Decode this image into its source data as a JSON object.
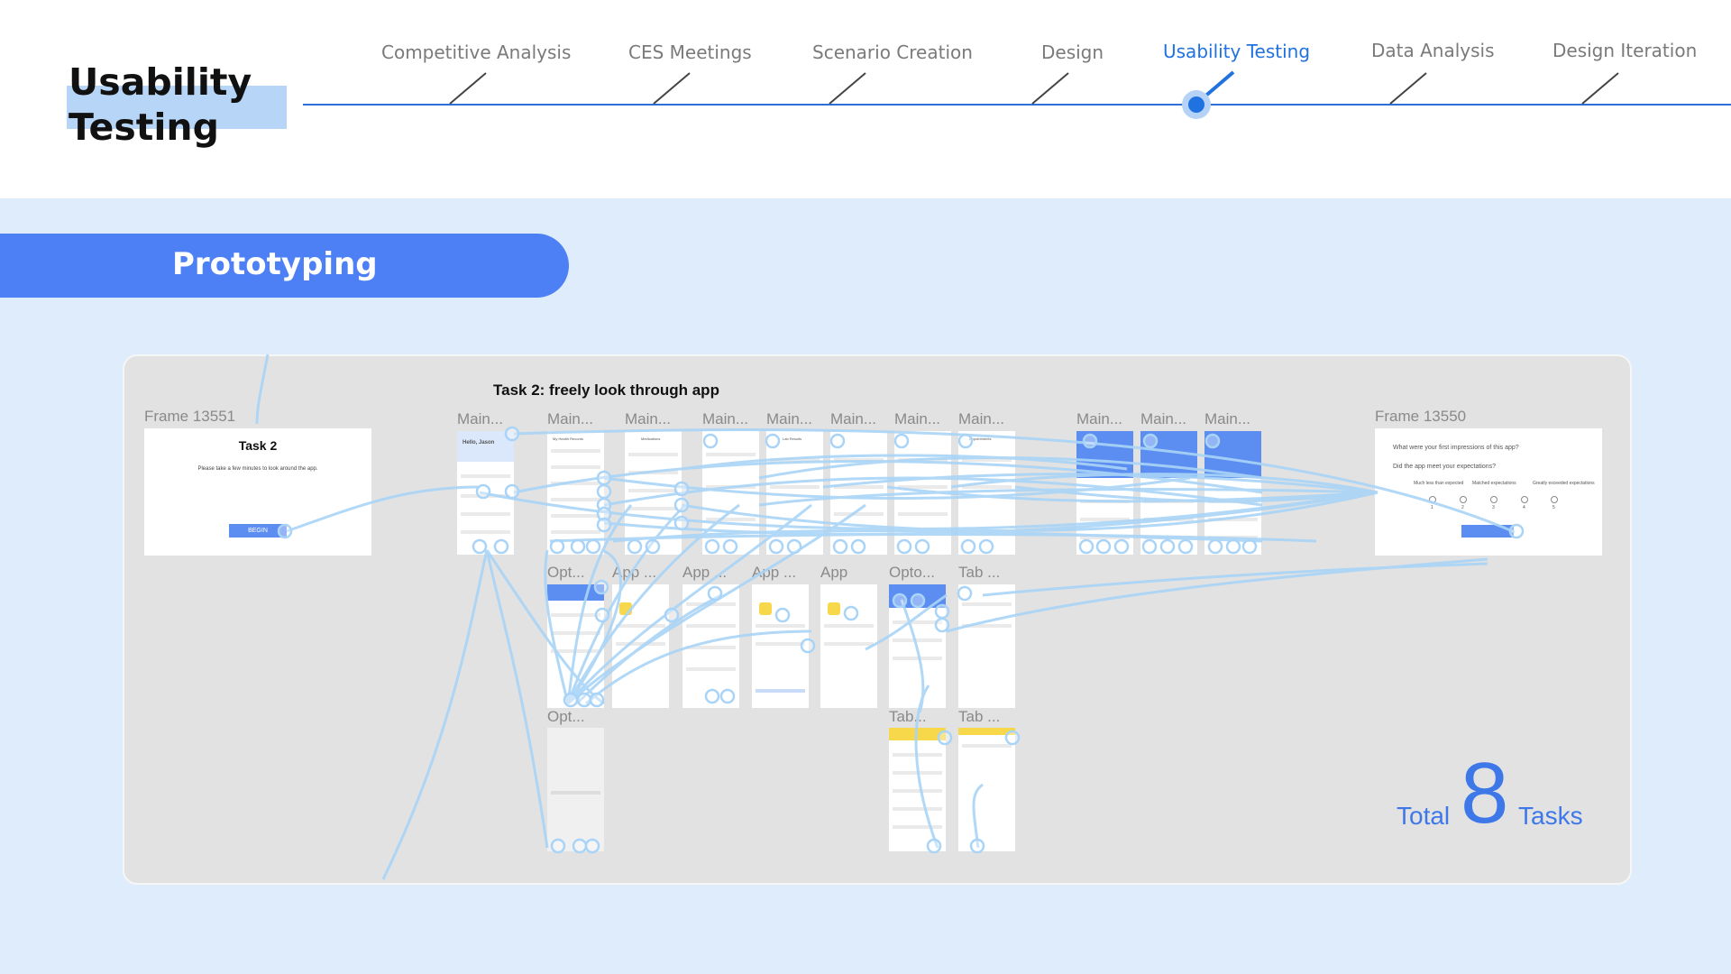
{
  "header": {
    "title": "Usability\nTesting",
    "stages": [
      {
        "label": "Competitive Analysis",
        "active": false
      },
      {
        "label": "CES Meetings",
        "active": false
      },
      {
        "label": "Scenario Creation",
        "active": false
      },
      {
        "label": "Design",
        "active": false
      },
      {
        "label": "Usability Testing",
        "active": true
      },
      {
        "label": "Data Analysis",
        "active": false
      },
      {
        "label": "Design Iteration",
        "active": false
      }
    ],
    "accent_color": "#1f72e0"
  },
  "section": {
    "title": "Prototyping",
    "pill_color": "#4d80f4"
  },
  "canvas": {
    "task_heading": "Task 2: freely look through app",
    "start_frame": {
      "label": "Frame 13551",
      "title": "Task 2",
      "subtitle": "Please take a few minutes to look around the app.",
      "button": "BEGIN"
    },
    "end_frame": {
      "label": "Frame 13550",
      "question1": "What were your first impressions of this app?",
      "question2": "Did the app meet your expectations?",
      "scale_left": "Much less than expected",
      "scale_mid": "Matched expectations",
      "scale_right": "Greatly exceeded expectations",
      "scale_numbers": [
        "1",
        "2",
        "3",
        "4",
        "5"
      ]
    },
    "row1_labels": [
      "Main...",
      "Main...",
      "Main...",
      "Main...",
      "Main...",
      "Main...",
      "Main...",
      "Main...",
      "Main...",
      "Main...",
      "Main..."
    ],
    "row2_labels": [
      "Opt...",
      "App ...",
      "App ...",
      "App ...",
      "App",
      "Opto...",
      "Tab ..."
    ],
    "row3_labels": [
      "Opt...",
      "Tab...",
      "Tab ..."
    ],
    "phone_texts": {
      "greeting": "Hello, Jason",
      "records": "My Health Records",
      "medications": "Medications",
      "lab_results": "Lab Results",
      "appointments": "Appointments"
    }
  },
  "summary": {
    "total_label": "Total",
    "count": "8",
    "tasks_label": "Tasks"
  },
  "colors": {
    "flow_line": "#a9d4f7",
    "main_bg": "#dfecfb",
    "canvas_bg": "#e2e2e2"
  }
}
